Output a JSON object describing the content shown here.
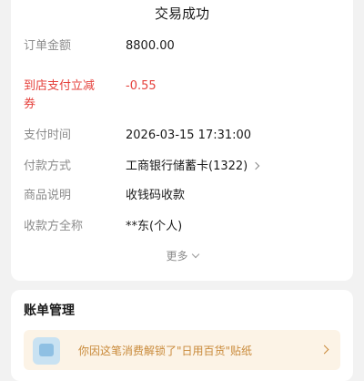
{
  "status_title": "交易成功",
  "details": [
    {
      "label": "订单金额",
      "value": "8800.00"
    },
    {
      "label": "到店支付立减券",
      "value": "-0.55"
    },
    {
      "label": "支付时间",
      "value": "2026-03-15 17:31:00"
    },
    {
      "label": "付款方式",
      "value": "工商银行储蓄卡(1322)"
    },
    {
      "label": "商品说明",
      "value": "收钱码收款"
    },
    {
      "label": "收款方全称",
      "value": "**东(个人)"
    }
  ],
  "discount_label_line1": "到店支付立减",
  "discount_label_line2": "券",
  "more_label": "更多",
  "bill": {
    "title": "账单管理",
    "banner_text": "你因这笔消费解锁了\"日用百货\"贴纸"
  },
  "colors": {
    "accent_red": "#e5413c",
    "banner_text": "#c98a3a"
  }
}
